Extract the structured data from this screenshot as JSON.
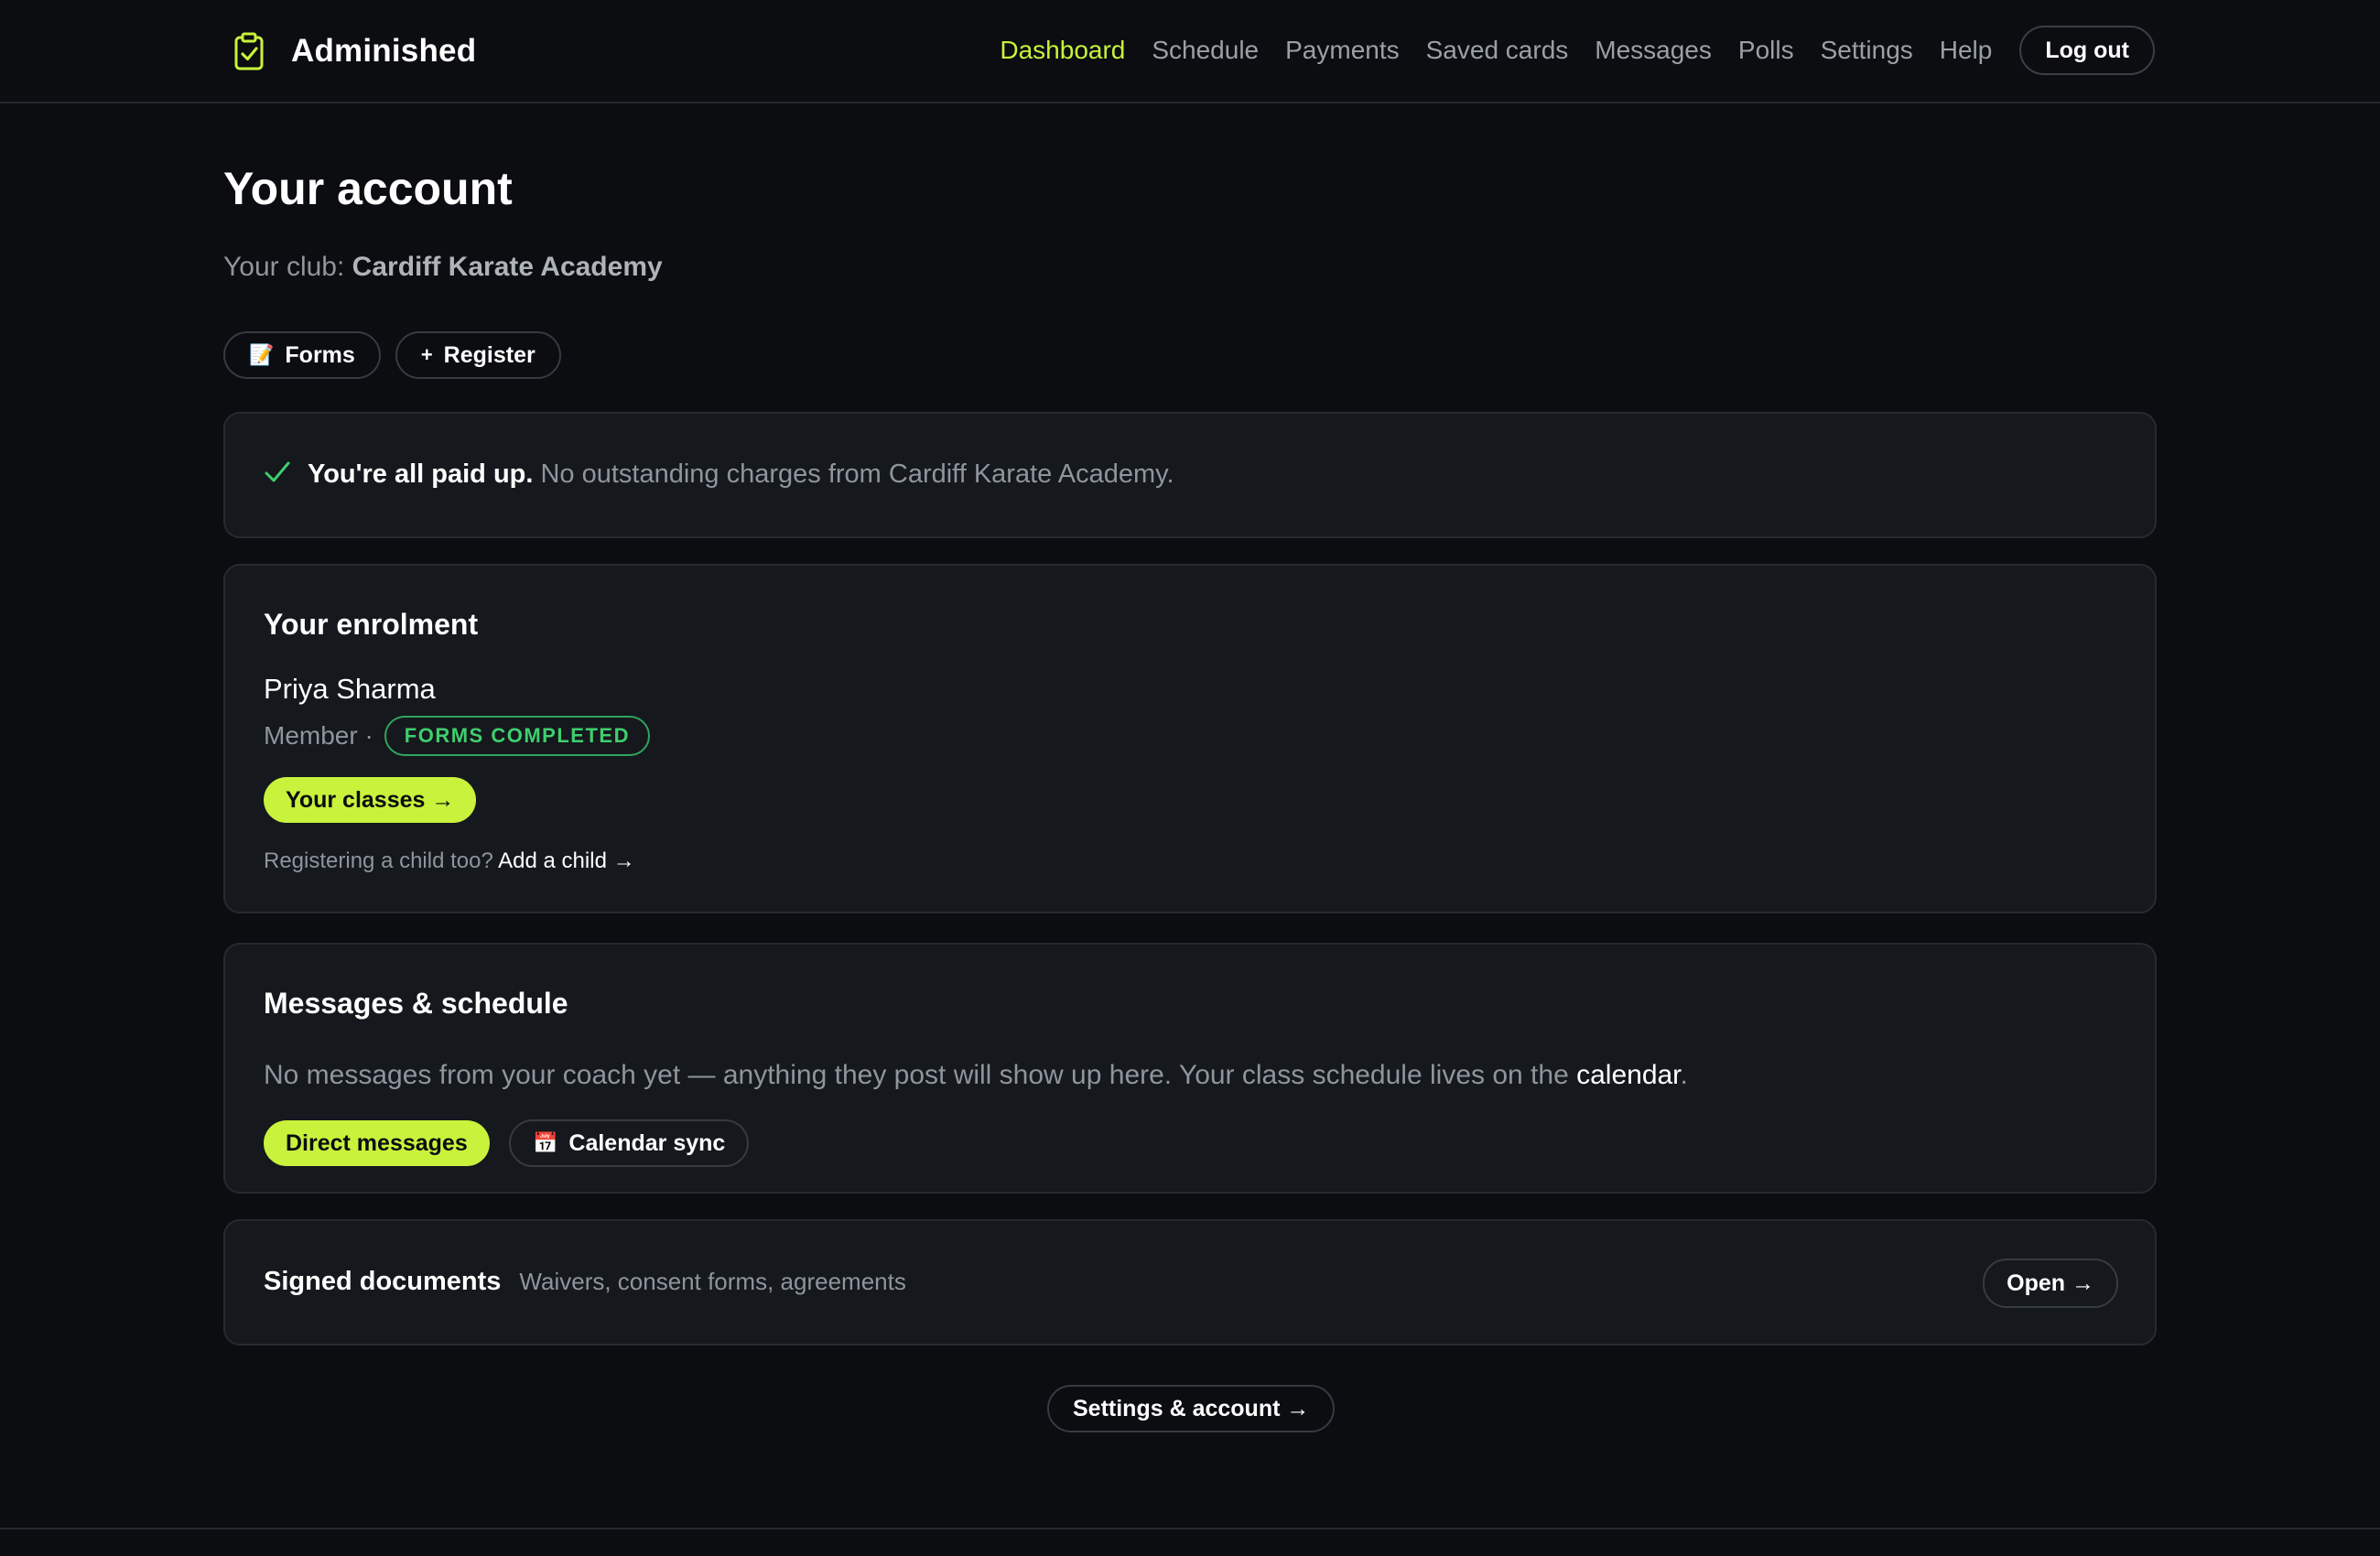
{
  "brand": {
    "name": "Adminished",
    "logo_icon": "clipboard-check-icon",
    "accent": "#c8f23c"
  },
  "nav": {
    "items": [
      {
        "label": "Dashboard",
        "active": true
      },
      {
        "label": "Schedule"
      },
      {
        "label": "Payments"
      },
      {
        "label": "Saved cards"
      },
      {
        "label": "Messages"
      },
      {
        "label": "Polls"
      },
      {
        "label": "Settings"
      },
      {
        "label": "Help"
      }
    ],
    "logout_label": "Log out"
  },
  "page": {
    "title": "Your account",
    "club_prefix": "Your club:",
    "club_name": "Cardiff Karate Academy"
  },
  "actions": {
    "forms_label": "Forms",
    "forms_icon": "📝",
    "register_label": "Register",
    "register_icon": "+"
  },
  "paid": {
    "icon": "✓",
    "headline": "You're all paid up.",
    "detail": "No outstanding charges from Cardiff Karate Academy.",
    "status_color": "#3ecf6e"
  },
  "enrolment": {
    "heading": "Your enrolment",
    "person": "Priya Sharma",
    "role": "Member ·",
    "badge": "FORMS COMPLETED",
    "classes_button": "Your classes →",
    "child_prompt": "Registering a child too?",
    "child_link": "Add a child →"
  },
  "messages": {
    "heading": "Messages & schedule",
    "text": "No messages from your coach yet — anything they post will show up here. Your class schedule lives on the",
    "calendar_link": "calendar",
    "text_end": ".",
    "dm_button": "Direct messages",
    "calendar_sync_button": "Calendar sync",
    "calendar_icon": "📅"
  },
  "documents": {
    "title": "Signed documents",
    "subtitle": "Waivers, consent forms, agreements",
    "open_button": "Open →"
  },
  "settings_button": "Settings & account →"
}
